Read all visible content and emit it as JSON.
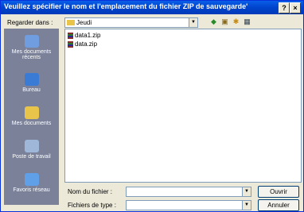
{
  "window": {
    "title": "Veuillez spécifier le nom et l'emplacement du fichier ZIP de sauvegarde'",
    "help_label": "?",
    "close_label": "×"
  },
  "toolbar": {
    "look_in_label": "Regarder dans :",
    "look_in_value": "Jeudi",
    "back_icon": "◆",
    "up_icon": "▣",
    "new_folder_icon": "✱",
    "views_icon": "▦"
  },
  "places": [
    {
      "label": "Mes documents récents",
      "icon": "recent-docs-icon",
      "color": "#6f9de0"
    },
    {
      "label": "Bureau",
      "icon": "desktop-icon",
      "color": "#3a7bd5"
    },
    {
      "label": "Mes documents",
      "icon": "my-documents-icon",
      "color": "#e8c44a"
    },
    {
      "label": "Poste de travail",
      "icon": "my-computer-icon",
      "color": "#9fb7d9"
    },
    {
      "label": "Favoris réseau",
      "icon": "network-icon",
      "color": "#5fa0e8"
    }
  ],
  "files": [
    "data1.zip",
    "data.zip"
  ],
  "form": {
    "filename_label": "Nom du fichier :",
    "filename_value": "",
    "filetype_label": "Fichiers de type :",
    "filetype_value": ""
  },
  "buttons": {
    "open": "Ouvrir",
    "cancel": "Annuler"
  }
}
